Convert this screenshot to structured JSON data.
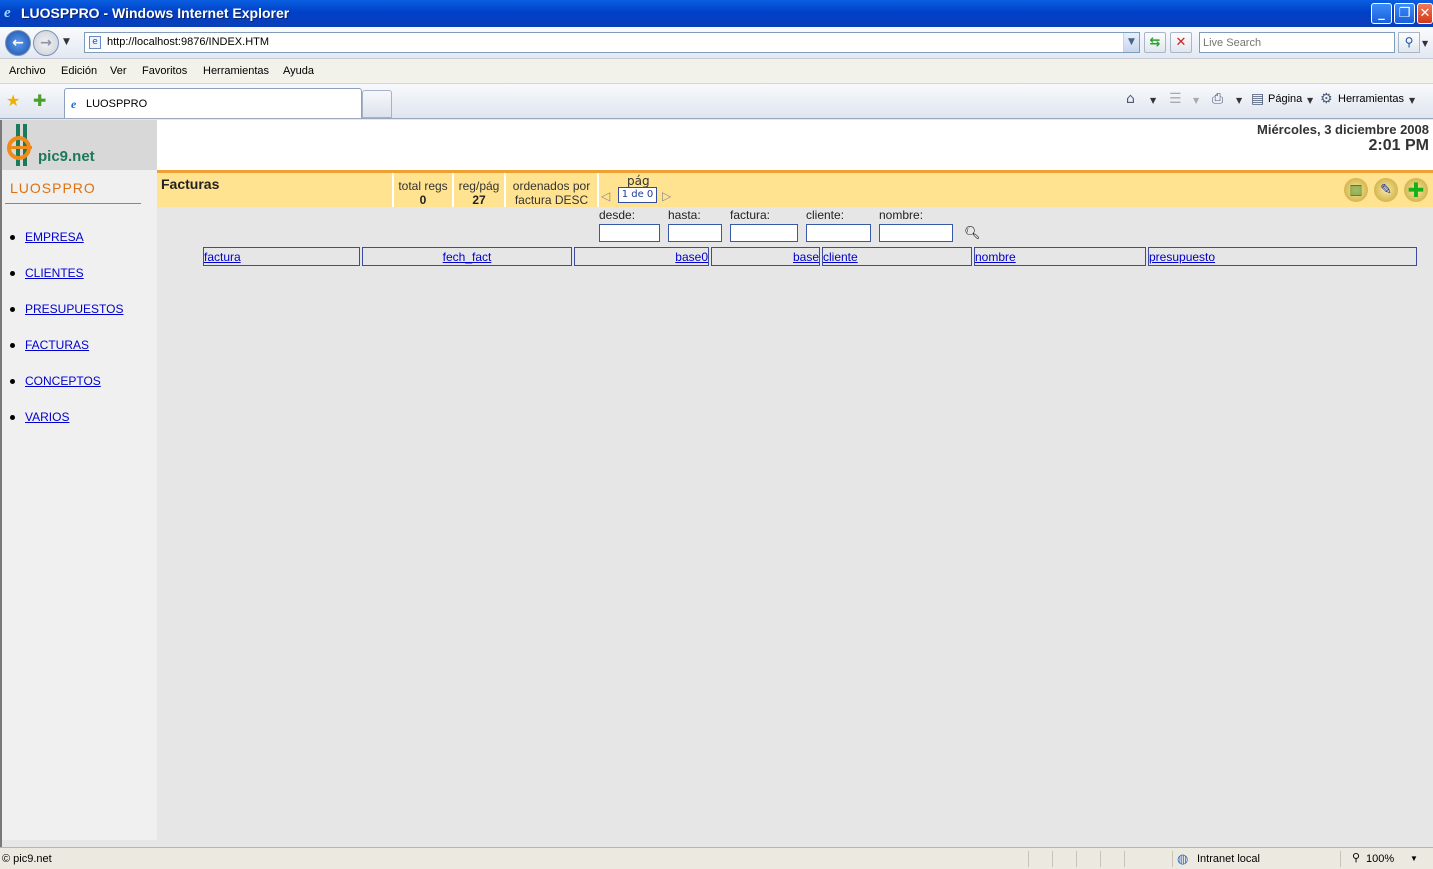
{
  "window": {
    "title": "LUOSPPRO - Windows Internet Explorer",
    "url": "http://localhost:9876/INDEX.HTM",
    "search_placeholder": "Live Search"
  },
  "menu": [
    "Archivo",
    "Edición",
    "Ver",
    "Favoritos",
    "Herramientas",
    "Ayuda"
  ],
  "tab": {
    "label": "LUOSPPRO"
  },
  "commands": {
    "page": "Página",
    "tools": "Herramientas"
  },
  "app": {
    "brand": "pic9.net",
    "name": "LUOSPPRO",
    "nav": [
      "EMPRESA",
      "CLIENTES",
      "PRESUPUESTOS",
      "FACTURAS",
      "CONCEPTOS",
      "VARIOS"
    ]
  },
  "header": {
    "date": "Miércoles, 3 diciembre 2008",
    "time": "2:01 PM"
  },
  "section": {
    "title": "Facturas",
    "total_label": "total regs",
    "total_value": "0",
    "perpage_label": "reg/pág",
    "perpage_value": "27",
    "order_label": "ordenados por",
    "order_value": "factura DESC",
    "page_label": "pág",
    "page_value": "1 de 0"
  },
  "filters": {
    "desde": "desde:",
    "hasta": "hasta:",
    "factura": "factura:",
    "cliente": "cliente:",
    "nombre": "nombre:"
  },
  "table": {
    "columns": [
      "factura",
      "fech_fact",
      "base0",
      "base",
      "cliente",
      "nombre",
      "presupuesto"
    ]
  },
  "status": {
    "left": "© pic9.net",
    "zone": "Intranet local",
    "zoom": "100%"
  },
  "colors": {
    "accent": "#f0a030",
    "header_bar": "#ffe390",
    "brand_orange": "#e07010"
  }
}
